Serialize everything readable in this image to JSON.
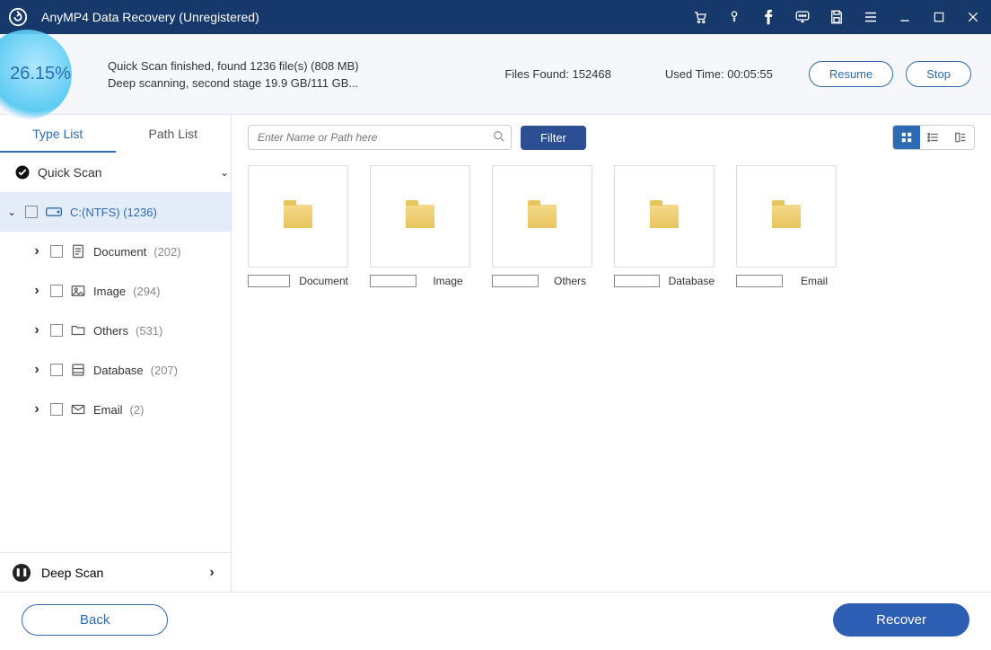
{
  "titlebar": {
    "title": "AnyMP4 Data Recovery (Unregistered)"
  },
  "status": {
    "percent": "26.15%",
    "line1": "Quick Scan finished, found 1236 file(s) (808 MB)",
    "line2": "Deep scanning, second stage 19.9 GB/111 GB...",
    "files_found_label": "Files Found: 152468",
    "used_time_label": "Used Time: 00:05:55",
    "resume": "Resume",
    "stop": "Stop"
  },
  "tabs": {
    "type_list": "Type List",
    "path_list": "Path List"
  },
  "tree": {
    "quick_scan": "Quick Scan",
    "drive": "C:(NTFS) (1236)",
    "cats": [
      {
        "label": "Document",
        "count": "(202)"
      },
      {
        "label": "Image",
        "count": "(294)"
      },
      {
        "label": "Others",
        "count": "(531)"
      },
      {
        "label": "Database",
        "count": "(207)"
      },
      {
        "label": "Email",
        "count": "(2)"
      }
    ],
    "deep_scan": "Deep Scan"
  },
  "toolbar": {
    "search_placeholder": "Enter Name or Path here",
    "filter": "Filter"
  },
  "tiles": [
    {
      "label": "Document"
    },
    {
      "label": "Image"
    },
    {
      "label": "Others"
    },
    {
      "label": "Database"
    },
    {
      "label": "Email"
    }
  ],
  "footer": {
    "back": "Back",
    "recover": "Recover"
  }
}
